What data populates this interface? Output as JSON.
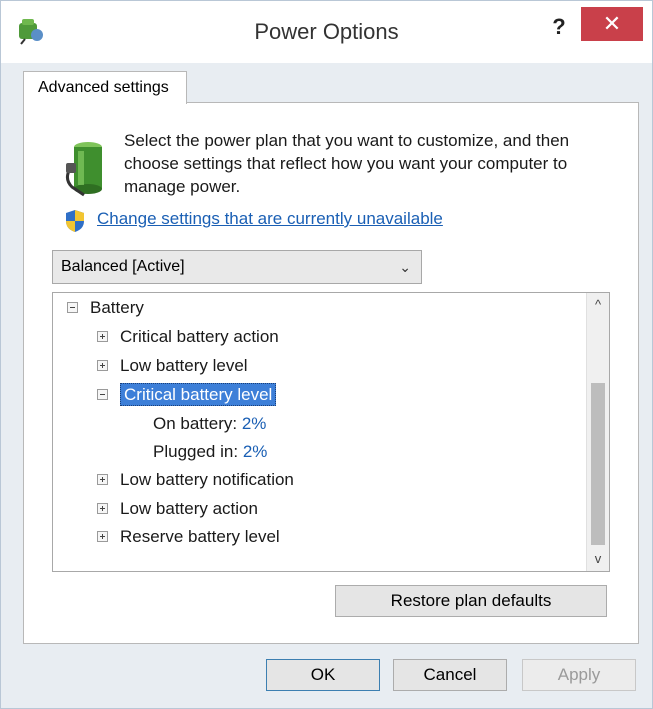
{
  "window": {
    "title": "Power Options",
    "help_label": "?",
    "close_label": "✕"
  },
  "tab": {
    "label": "Advanced settings"
  },
  "description": "Select the power plan that you want to customize, and then choose settings that reflect how you want your computer to manage power.",
  "change_link": "Change settings that are currently unavailable",
  "plan_select": {
    "value": "Balanced [Active]",
    "chevron": "⌄"
  },
  "tree": {
    "battery": "Battery",
    "critical_action": "Critical battery action",
    "low_level": "Low battery level",
    "critical_level": "Critical battery level",
    "on_battery_label": "On battery:",
    "on_battery_value": "2%",
    "plugged_in_label": "Plugged in:",
    "plugged_in_value": "2%",
    "low_notification": "Low battery notification",
    "low_action": "Low battery action",
    "reserve_level": "Reserve battery level"
  },
  "scrollbar": {
    "up": "^",
    "down": "v"
  },
  "buttons": {
    "restore": "Restore plan defaults",
    "ok": "OK",
    "cancel": "Cancel",
    "apply": "Apply"
  },
  "colors": {
    "link": "#1a5fb4",
    "selection": "#3d7fd8",
    "close": "#c9404a"
  },
  "icons": {
    "app": "power-options-icon",
    "battery": "battery-plug-icon",
    "shield": "uac-shield-icon"
  }
}
